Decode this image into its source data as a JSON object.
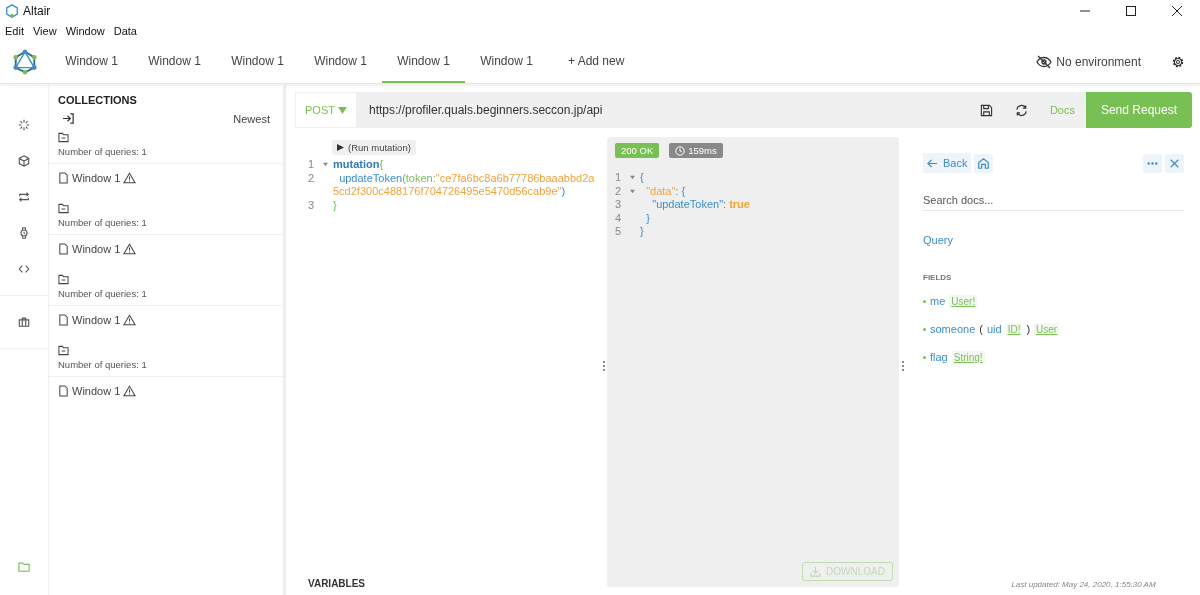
{
  "window": {
    "title": "Altair"
  },
  "menu": [
    "Edit",
    "View",
    "Window",
    "Data"
  ],
  "tabs": [
    {
      "label": "Window 1",
      "selected": false
    },
    {
      "label": "Window 1",
      "selected": false
    },
    {
      "label": "Window 1",
      "selected": false
    },
    {
      "label": "Window 1",
      "selected": false
    },
    {
      "label": "Window 1",
      "selected": true
    },
    {
      "label": "Window 1",
      "selected": false
    }
  ],
  "add_tab": "+ Add new",
  "environment": "No environment",
  "collections": {
    "title": "COLLECTIONS",
    "sort": "Newest",
    "groups": [
      {
        "count_text": "Number of queries: 1",
        "queries": [
          {
            "title": "Window 1",
            "warning": true
          }
        ]
      },
      {
        "count_text": "Number of queries: 1",
        "queries": [
          {
            "title": "Window 1",
            "warning": true
          }
        ]
      },
      {
        "count_text": "Number of queries: 1",
        "queries": [
          {
            "title": "Window 1",
            "warning": true
          }
        ]
      },
      {
        "count_text": "Number of queries: 1",
        "queries": [
          {
            "title": "Window 1",
            "warning": true
          }
        ]
      }
    ]
  },
  "request": {
    "method": "POST",
    "url": "https://profiler.quals.beginners.seccon.jp/api",
    "docs": "Docs",
    "send": "Send Request"
  },
  "query_editor": {
    "run_button": "(Run mutation)",
    "lines": [
      {
        "number": "1",
        "fold": true,
        "tokens": [
          {
            "kind": "keyword",
            "text": "mutation"
          },
          {
            "kind": "brace",
            "text": "{"
          }
        ]
      },
      {
        "number": "2",
        "fold": false,
        "tokens": [
          {
            "kind": "field",
            "text": "  updateToken"
          },
          {
            "kind": "brace",
            "text": "("
          },
          {
            "kind": "argument",
            "text": "token:"
          },
          {
            "kind": "string",
            "text": "\"ce7fa6bc8a6b77786baaabbd2a5cd2f300c488176f704726495e5470d56cab9e\""
          },
          {
            "kind": "punct",
            "text": ")"
          }
        ]
      },
      {
        "number": "3",
        "fold": false,
        "tokens": [
          {
            "kind": "brace",
            "text": "}"
          }
        ]
      }
    ],
    "variables": "VARIABLES"
  },
  "response": {
    "status": "200 OK",
    "time": "159ms",
    "lines": [
      {
        "number": "1",
        "fold": true,
        "tokens": [
          {
            "kind": "punct",
            "text": "{"
          }
        ]
      },
      {
        "number": "2",
        "fold": true,
        "tokens": [
          {
            "kind": "key",
            "text": "  \"data\""
          },
          {
            "kind": "punct",
            "text": ": {"
          }
        ]
      },
      {
        "number": "3",
        "fold": false,
        "tokens": [
          {
            "kind": "field",
            "text": "    \"updateToken\""
          },
          {
            "kind": "punct",
            "text": ": "
          },
          {
            "kind": "value",
            "text": "true"
          }
        ]
      },
      {
        "number": "4",
        "fold": false,
        "tokens": [
          {
            "kind": "punct",
            "text": "  }"
          }
        ]
      },
      {
        "number": "5",
        "fold": false,
        "tokens": [
          {
            "kind": "punct",
            "text": "}"
          }
        ]
      }
    ],
    "download": {
      "label": "DOWNLOAD",
      "disabled": true
    }
  },
  "docs": {
    "back": "Back",
    "search": {
      "placeholder": "Search docs..."
    },
    "root": "Query",
    "fields_heading": "FIELDS",
    "fields": [
      {
        "name": "me",
        "type": "User!"
      },
      {
        "name": "someone",
        "open": "(",
        "args": [
          {
            "name": "uid",
            "type": "ID!"
          }
        ],
        "close": ")",
        "type": "User"
      },
      {
        "name": "flag",
        "type": "String!"
      }
    ],
    "last_updated": "Last updated: May 24, 2020, 1:55:30 AM"
  }
}
